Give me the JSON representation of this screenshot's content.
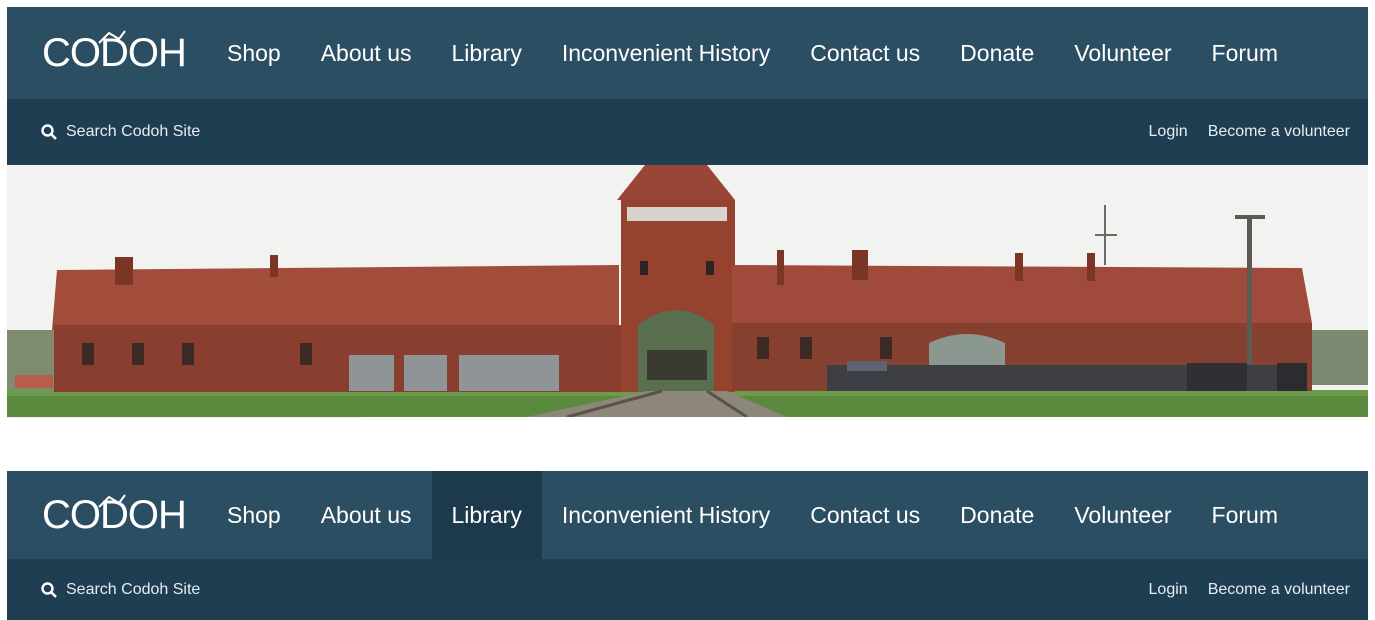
{
  "brand": {
    "logo_text": "CODOH"
  },
  "nav": {
    "items": [
      {
        "label": "Shop"
      },
      {
        "label": "About us"
      },
      {
        "label": "Library"
      },
      {
        "label": "Inconvenient History"
      },
      {
        "label": "Contact us"
      },
      {
        "label": "Donate"
      },
      {
        "label": "Volunteer"
      },
      {
        "label": "Forum"
      }
    ]
  },
  "subbar": {
    "search_text": "Search Codoh Site",
    "login": "Login",
    "become_volunteer": "Become a volunteer"
  },
  "second_header": {
    "active_item": "Library"
  },
  "colors": {
    "navbar": "#2c4e63",
    "subbar": "#1f3e52",
    "active_tab": "#1d3a4d",
    "text": "#ffffff"
  },
  "icons": {
    "search": "search-icon"
  }
}
